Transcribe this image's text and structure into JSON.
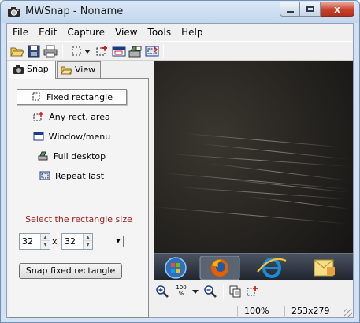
{
  "window": {
    "title": "MWSnap - Noname",
    "close_glyph": "x"
  },
  "menu": [
    "File",
    "Edit",
    "Capture",
    "View",
    "Tools",
    "Help"
  ],
  "toolbar": {
    "buttons": [
      "open-icon",
      "save-icon",
      "print-icon",
      "fixed-rect-icon",
      "dropdown-arrow-icon",
      "any-rect-icon",
      "window-menu-icon",
      "full-desktop-icon",
      "repeat-last-icon"
    ]
  },
  "tabs": [
    {
      "label": "Snap",
      "icon": "camera-icon",
      "active": true
    },
    {
      "label": "View",
      "icon": "folder-icon",
      "active": false
    }
  ],
  "snap_panel": {
    "modes": [
      {
        "label": "Fixed rectangle",
        "icon": "fixed-rect-icon",
        "selected": true
      },
      {
        "label": "Any rect. area",
        "icon": "any-rect-icon",
        "selected": false
      },
      {
        "label": "Window/menu",
        "icon": "window-menu-icon",
        "selected": false
      },
      {
        "label": "Full desktop",
        "icon": "full-desktop-icon",
        "selected": false
      },
      {
        "label": "Repeat last",
        "icon": "repeat-last-icon",
        "selected": false
      }
    ],
    "size_hint": "Select the rectangle size",
    "width_value": "32",
    "times": "x",
    "height_value": "32",
    "snap_button": "Snap fixed rectangle",
    "hint_color": "#a02020"
  },
  "zoom_toolbar": {
    "zoom_pct_label": "100",
    "zoom_pct_sign": "%",
    "buttons": [
      "zoom-in-icon",
      "zoom-100-icon",
      "dropdown-arrow-icon",
      "zoom-out-icon",
      "copy-icon",
      "any-rect-icon"
    ]
  },
  "status": {
    "zoom": "100%",
    "size": "253x279"
  },
  "colors": {
    "taskbar": "#2a323c",
    "title_accent": "#c8412b",
    "firefox": "#e66000",
    "ie": "#1f8ad6",
    "windows_orb": "#2e6fc0"
  }
}
